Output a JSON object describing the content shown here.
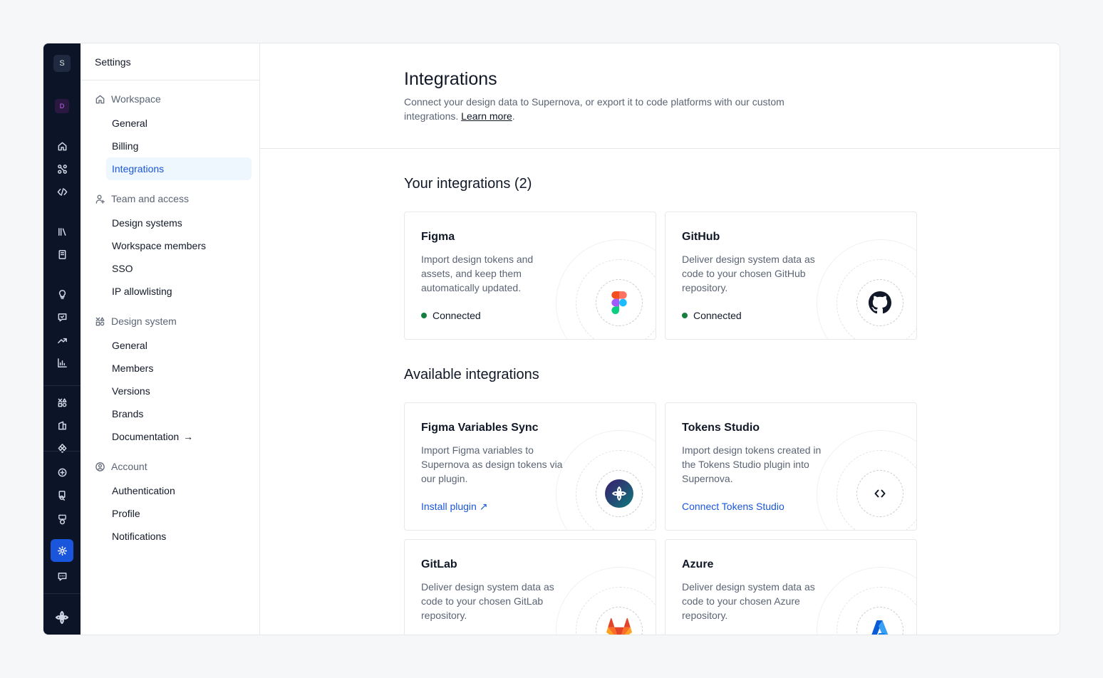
{
  "rail": {
    "workspace_badge": "S",
    "design_system_badge": "D",
    "icons": [
      "home-icon",
      "tokens-icon",
      "code-icon",
      "library-icon",
      "book-icon",
      "lightbulb-icon",
      "feedback-icon",
      "trend-icon",
      "analytics-icon",
      "components-icon",
      "assets-icon",
      "figma-icon",
      "figma-sync-icon",
      "search-doc-icon",
      "inspect-icon",
      "settings-icon",
      "chat-icon",
      "supernova-logo-icon"
    ]
  },
  "sidenav": {
    "title": "Settings",
    "groups": [
      {
        "label": "Workspace",
        "icon": "home-icon",
        "items": [
          "General",
          "Billing",
          "Integrations"
        ]
      },
      {
        "label": "Team and access",
        "icon": "user-plus-icon",
        "items": [
          "Design systems",
          "Workspace members",
          "SSO",
          "IP allowlisting"
        ]
      },
      {
        "label": "Design system",
        "icon": "components-icon",
        "items": [
          "General",
          "Members",
          "Versions",
          "Brands",
          "Documentation"
        ]
      },
      {
        "label": "Account",
        "icon": "user-circle-icon",
        "items": [
          "Authentication",
          "Profile",
          "Notifications"
        ]
      }
    ],
    "documentation_arrow": "→",
    "active_item": "Integrations"
  },
  "header": {
    "title": "Integrations",
    "description": "Connect your design data to Supernova, or export it to code platforms with our custom integrations. ",
    "learn_more": "Learn more",
    "period": "."
  },
  "your_integrations": {
    "title": "Your integrations (2)",
    "cards": [
      {
        "title": "Figma",
        "description": "Import design tokens and assets, and keep them automatically updated.",
        "status": "Connected",
        "status_color": "#15803d",
        "logo": "figma-logo-icon"
      },
      {
        "title": "GitHub",
        "description": "Deliver design system data as code to your chosen GitHub repository.",
        "status": "Connected",
        "status_color": "#15803d",
        "logo": "github-logo-icon"
      }
    ]
  },
  "available_integrations": {
    "title": "Available integrations",
    "cards": [
      {
        "title": "Figma Variables Sync",
        "description": "Import Figma variables to Supernova as design tokens via our plugin.",
        "link": "Install plugin ↗",
        "logo": "supernova-plugin-icon"
      },
      {
        "title": "Tokens Studio",
        "description": "Import design tokens created in the Tokens Studio plugin into Supernova.",
        "link": "Connect Tokens Studio",
        "logo": "tokens-studio-icon"
      },
      {
        "title": "GitLab",
        "description": "Deliver design system data as code to your chosen GitLab repository.",
        "logo": "gitlab-logo-icon"
      },
      {
        "title": "Azure",
        "description": "Deliver design system data as code to your chosen Azure repository.",
        "logo": "azure-logo-icon"
      }
    ]
  },
  "colors": {
    "accent": "#1a56db",
    "rail_bg": "#0c1428",
    "active_nav_bg": "#eef6fe",
    "connected": "#15803d"
  }
}
